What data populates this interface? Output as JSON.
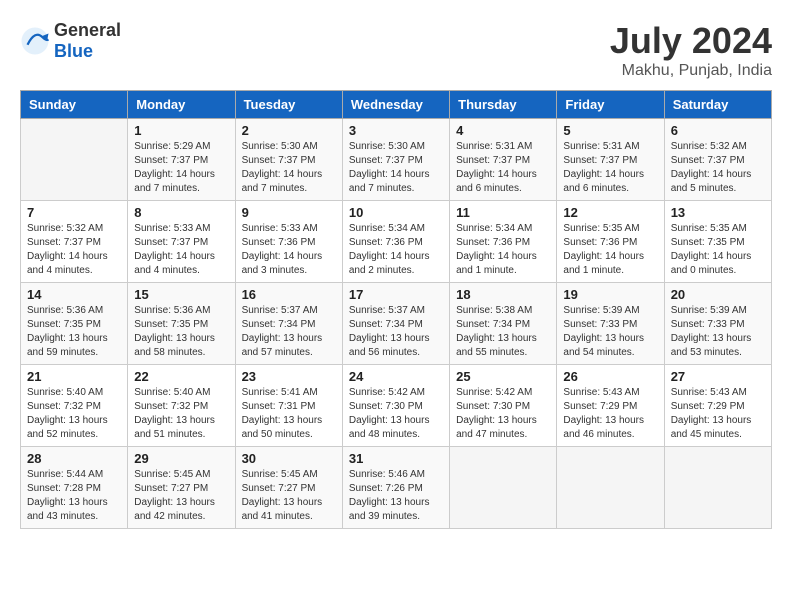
{
  "header": {
    "logo_general": "General",
    "logo_blue": "Blue",
    "month": "July 2024",
    "location": "Makhu, Punjab, India"
  },
  "weekdays": [
    "Sunday",
    "Monday",
    "Tuesday",
    "Wednesday",
    "Thursday",
    "Friday",
    "Saturday"
  ],
  "weeks": [
    [
      {
        "day": "",
        "sunrise": "",
        "sunset": "",
        "daylight": ""
      },
      {
        "day": "1",
        "sunrise": "Sunrise: 5:29 AM",
        "sunset": "Sunset: 7:37 PM",
        "daylight": "Daylight: 14 hours and 7 minutes."
      },
      {
        "day": "2",
        "sunrise": "Sunrise: 5:30 AM",
        "sunset": "Sunset: 7:37 PM",
        "daylight": "Daylight: 14 hours and 7 minutes."
      },
      {
        "day": "3",
        "sunrise": "Sunrise: 5:30 AM",
        "sunset": "Sunset: 7:37 PM",
        "daylight": "Daylight: 14 hours and 7 minutes."
      },
      {
        "day": "4",
        "sunrise": "Sunrise: 5:31 AM",
        "sunset": "Sunset: 7:37 PM",
        "daylight": "Daylight: 14 hours and 6 minutes."
      },
      {
        "day": "5",
        "sunrise": "Sunrise: 5:31 AM",
        "sunset": "Sunset: 7:37 PM",
        "daylight": "Daylight: 14 hours and 6 minutes."
      },
      {
        "day": "6",
        "sunrise": "Sunrise: 5:32 AM",
        "sunset": "Sunset: 7:37 PM",
        "daylight": "Daylight: 14 hours and 5 minutes."
      }
    ],
    [
      {
        "day": "7",
        "sunrise": "Sunrise: 5:32 AM",
        "sunset": "Sunset: 7:37 PM",
        "daylight": "Daylight: 14 hours and 4 minutes."
      },
      {
        "day": "8",
        "sunrise": "Sunrise: 5:33 AM",
        "sunset": "Sunset: 7:37 PM",
        "daylight": "Daylight: 14 hours and 4 minutes."
      },
      {
        "day": "9",
        "sunrise": "Sunrise: 5:33 AM",
        "sunset": "Sunset: 7:36 PM",
        "daylight": "Daylight: 14 hours and 3 minutes."
      },
      {
        "day": "10",
        "sunrise": "Sunrise: 5:34 AM",
        "sunset": "Sunset: 7:36 PM",
        "daylight": "Daylight: 14 hours and 2 minutes."
      },
      {
        "day": "11",
        "sunrise": "Sunrise: 5:34 AM",
        "sunset": "Sunset: 7:36 PM",
        "daylight": "Daylight: 14 hours and 1 minute."
      },
      {
        "day": "12",
        "sunrise": "Sunrise: 5:35 AM",
        "sunset": "Sunset: 7:36 PM",
        "daylight": "Daylight: 14 hours and 1 minute."
      },
      {
        "day": "13",
        "sunrise": "Sunrise: 5:35 AM",
        "sunset": "Sunset: 7:35 PM",
        "daylight": "Daylight: 14 hours and 0 minutes."
      }
    ],
    [
      {
        "day": "14",
        "sunrise": "Sunrise: 5:36 AM",
        "sunset": "Sunset: 7:35 PM",
        "daylight": "Daylight: 13 hours and 59 minutes."
      },
      {
        "day": "15",
        "sunrise": "Sunrise: 5:36 AM",
        "sunset": "Sunset: 7:35 PM",
        "daylight": "Daylight: 13 hours and 58 minutes."
      },
      {
        "day": "16",
        "sunrise": "Sunrise: 5:37 AM",
        "sunset": "Sunset: 7:34 PM",
        "daylight": "Daylight: 13 hours and 57 minutes."
      },
      {
        "day": "17",
        "sunrise": "Sunrise: 5:37 AM",
        "sunset": "Sunset: 7:34 PM",
        "daylight": "Daylight: 13 hours and 56 minutes."
      },
      {
        "day": "18",
        "sunrise": "Sunrise: 5:38 AM",
        "sunset": "Sunset: 7:34 PM",
        "daylight": "Daylight: 13 hours and 55 minutes."
      },
      {
        "day": "19",
        "sunrise": "Sunrise: 5:39 AM",
        "sunset": "Sunset: 7:33 PM",
        "daylight": "Daylight: 13 hours and 54 minutes."
      },
      {
        "day": "20",
        "sunrise": "Sunrise: 5:39 AM",
        "sunset": "Sunset: 7:33 PM",
        "daylight": "Daylight: 13 hours and 53 minutes."
      }
    ],
    [
      {
        "day": "21",
        "sunrise": "Sunrise: 5:40 AM",
        "sunset": "Sunset: 7:32 PM",
        "daylight": "Daylight: 13 hours and 52 minutes."
      },
      {
        "day": "22",
        "sunrise": "Sunrise: 5:40 AM",
        "sunset": "Sunset: 7:32 PM",
        "daylight": "Daylight: 13 hours and 51 minutes."
      },
      {
        "day": "23",
        "sunrise": "Sunrise: 5:41 AM",
        "sunset": "Sunset: 7:31 PM",
        "daylight": "Daylight: 13 hours and 50 minutes."
      },
      {
        "day": "24",
        "sunrise": "Sunrise: 5:42 AM",
        "sunset": "Sunset: 7:30 PM",
        "daylight": "Daylight: 13 hours and 48 minutes."
      },
      {
        "day": "25",
        "sunrise": "Sunrise: 5:42 AM",
        "sunset": "Sunset: 7:30 PM",
        "daylight": "Daylight: 13 hours and 47 minutes."
      },
      {
        "day": "26",
        "sunrise": "Sunrise: 5:43 AM",
        "sunset": "Sunset: 7:29 PM",
        "daylight": "Daylight: 13 hours and 46 minutes."
      },
      {
        "day": "27",
        "sunrise": "Sunrise: 5:43 AM",
        "sunset": "Sunset: 7:29 PM",
        "daylight": "Daylight: 13 hours and 45 minutes."
      }
    ],
    [
      {
        "day": "28",
        "sunrise": "Sunrise: 5:44 AM",
        "sunset": "Sunset: 7:28 PM",
        "daylight": "Daylight: 13 hours and 43 minutes."
      },
      {
        "day": "29",
        "sunrise": "Sunrise: 5:45 AM",
        "sunset": "Sunset: 7:27 PM",
        "daylight": "Daylight: 13 hours and 42 minutes."
      },
      {
        "day": "30",
        "sunrise": "Sunrise: 5:45 AM",
        "sunset": "Sunset: 7:27 PM",
        "daylight": "Daylight: 13 hours and 41 minutes."
      },
      {
        "day": "31",
        "sunrise": "Sunrise: 5:46 AM",
        "sunset": "Sunset: 7:26 PM",
        "daylight": "Daylight: 13 hours and 39 minutes."
      },
      {
        "day": "",
        "sunrise": "",
        "sunset": "",
        "daylight": ""
      },
      {
        "day": "",
        "sunrise": "",
        "sunset": "",
        "daylight": ""
      },
      {
        "day": "",
        "sunrise": "",
        "sunset": "",
        "daylight": ""
      }
    ]
  ]
}
